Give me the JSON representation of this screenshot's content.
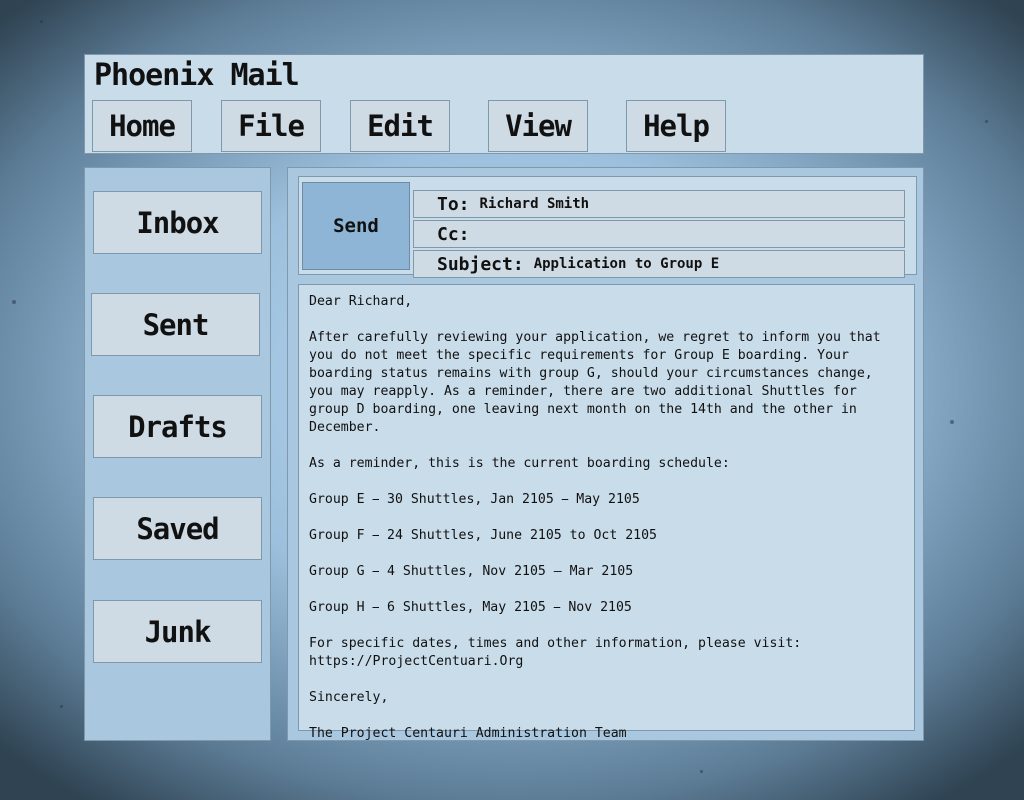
{
  "app": {
    "title": "Phoenix Mail"
  },
  "menu": {
    "items": [
      {
        "label": "Home"
      },
      {
        "label": "File"
      },
      {
        "label": "Edit"
      },
      {
        "label": "View"
      },
      {
        "label": "Help"
      }
    ]
  },
  "sidebar": {
    "items": [
      {
        "label": "Inbox"
      },
      {
        "label": "Sent"
      },
      {
        "label": "Drafts"
      },
      {
        "label": "Saved"
      },
      {
        "label": "Junk"
      }
    ]
  },
  "compose": {
    "send_label": "Send",
    "to_label": "To:",
    "to_value": "Richard Smith",
    "cc_label": "Cc:",
    "cc_value": "",
    "subject_label": "Subject:",
    "subject_value": "Application to Group E"
  },
  "message": {
    "greeting": "Dear Richard,",
    "para1": "After carefully reviewing your application, we regret to inform you that you do not meet the specific requirements for Group E boarding.  Your boarding status remains with group G, should your circumstances change, you may reapply. As a reminder, there are two additional Shuttles for group D boarding, one leaving next month on the 14th and the other in December.",
    "para2": "As a reminder, this is the current boarding schedule:",
    "schedule": [
      "Group E ⎯ 30 Shuttles, Jan 2105 ⎯ May 2105",
      "Group F ⎯ 24 Shuttles, June 2105 to Oct 2105",
      "Group G ⎯  4 Shuttles,  Nov 2105 – Mar 2105",
      "Group H ⎯  6 Shuttles, May 2105 ⎯ Nov 2105"
    ],
    "info_line": "For specific dates, times and other information, please visit:",
    "link": "https://ProjectCentuari.Org",
    "closing": "Sincerely,",
    "signature": "The Project Centauri Administration Team"
  },
  "colors": {
    "panel": "#c9dcea",
    "panel_dark": "#a9c8e0",
    "button": "#cfdbe4",
    "send_button": "#8fb5d6",
    "border": "#7f98ab"
  }
}
